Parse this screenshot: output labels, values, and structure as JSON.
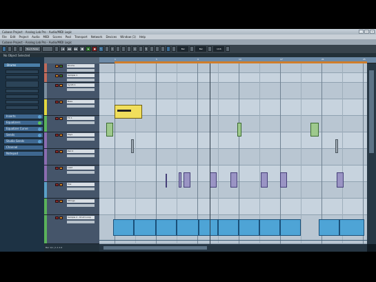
{
  "window": {
    "title": "Cubase Project - Analog Lab Pro - Audio/MIDI Logic"
  },
  "menubar": [
    "File",
    "Edit",
    "Project",
    "Audio",
    "MIDI",
    "Scores",
    "Pool",
    "Transport",
    "Network",
    "Devices",
    "Window (1)",
    "Help"
  ],
  "project_bar": {
    "label": "Cubase Project - Analog Lab Pro - Audio/MIDI Logic"
  },
  "toolbar": {
    "touch_mode": "Touch Fader",
    "position": "Bar",
    "grid": "Bar",
    "quantize": "1/16",
    "transport_labels": [
      "|◀",
      "◀◀",
      "▶▶",
      "■",
      "▶",
      "●"
    ]
  },
  "info_line": {
    "text": "No Object Selected"
  },
  "inspector": {
    "header": "Drums",
    "sections": [
      "Inserts",
      "Equalizers",
      "Equalizer Curve",
      "Sends",
      "Studio Sends",
      "Channel",
      "Notepad"
    ]
  },
  "tracks": [
    {
      "name": "Drums",
      "color": "#c06a5a"
    },
    {
      "name": "Sample 1",
      "color": "#c06a5a"
    },
    {
      "name": "Synth 1",
      "color": "#7b8e9e"
    },
    {
      "name": "Bass",
      "color": "#e3d740"
    },
    {
      "name": "FX 1",
      "color": "#5ab25a"
    },
    {
      "name": "Keys",
      "color": "#8b6cb0"
    },
    {
      "name": "Pad 2",
      "color": "#8b6cb0"
    },
    {
      "name": "Lead",
      "color": "#8b6cb0"
    },
    {
      "name": "Vox",
      "color": "#5aa0c8"
    },
    {
      "name": "Strings",
      "color": "#5ab25a"
    },
    {
      "name": "Sample 2 - Drum Loop",
      "color": "#5ab25a"
    }
  ],
  "ruler": {
    "ticks": [
      "1",
      "5",
      "9",
      "13",
      "17",
      "21",
      "25"
    ]
  },
  "bottom_left": "Bar 1/1 | 1.1.1.0",
  "colors": {
    "accent": "#4a7ea8",
    "loop": "#d07d2a",
    "audio_part": "#4ea4d6"
  }
}
